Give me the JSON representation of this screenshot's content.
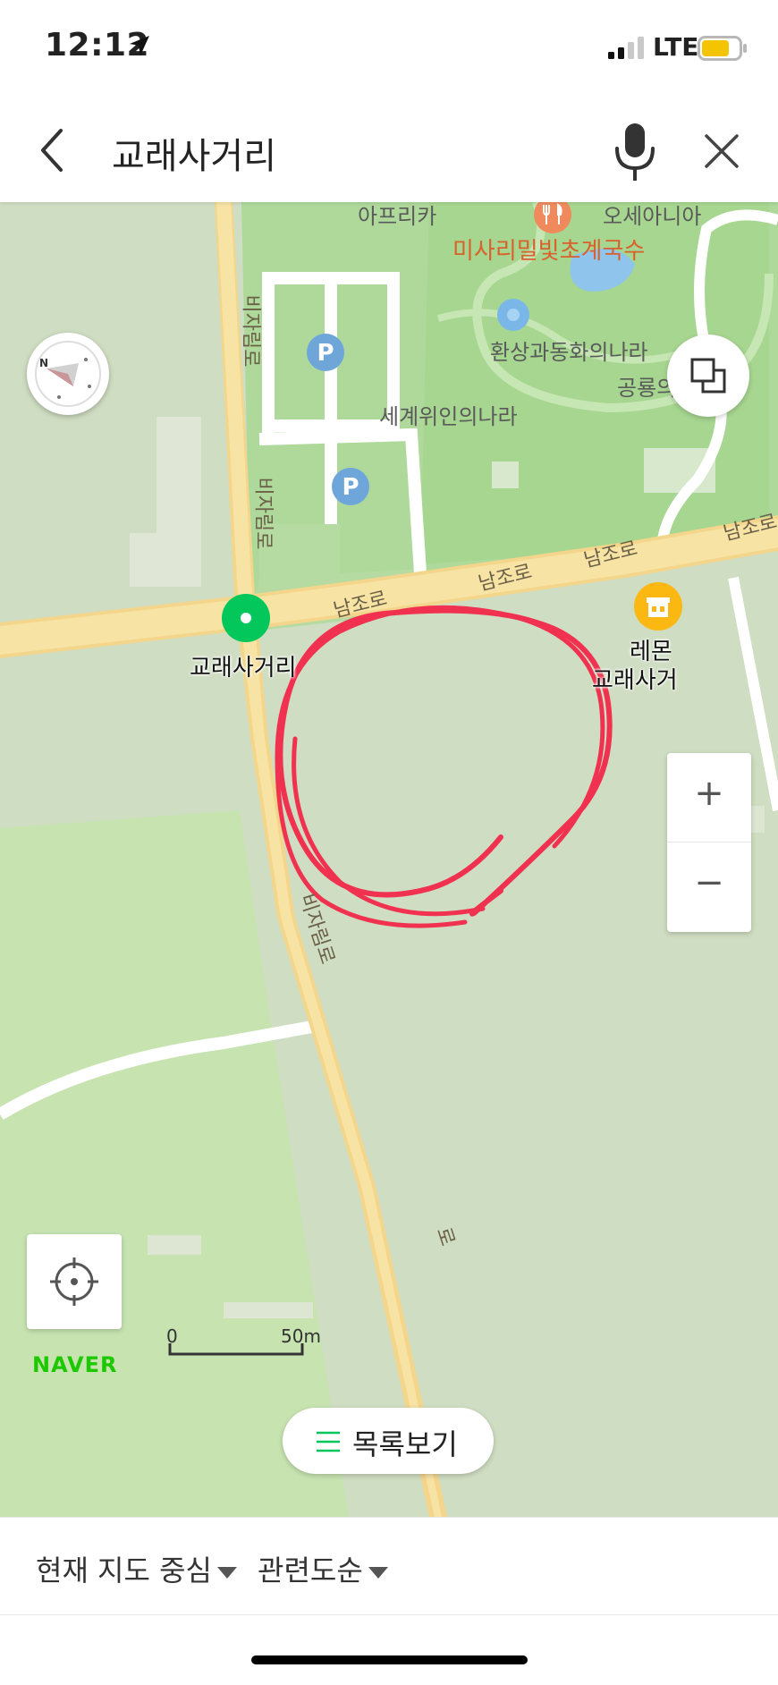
{
  "status_bar": {
    "time": "12:12",
    "network": "LTE",
    "location_icon": "location-arrow-icon",
    "signal_icon": "signal-bars-icon",
    "battery_icon": "battery-low-icon",
    "battery_color": "#f5c400"
  },
  "search": {
    "query": "교래사거리",
    "back_icon": "chevron-left-icon",
    "mic_icon": "microphone-icon",
    "clear_icon": "close-icon"
  },
  "map": {
    "place_labels": {
      "africa": "아프리카",
      "oceania": "오세아니아",
      "restaurant": "미사리밀빛초계국수",
      "fantasy": "환상과동화의나라",
      "dinosaur": "공룡의나라",
      "great_people": "세계위인의나라",
      "selected_place": "교래사거리",
      "lemon_line1": "레몬",
      "lemon_line2": "교래사거"
    },
    "road_labels": {
      "bija_1": "비자림로",
      "bija_2": "비자림로",
      "bija_3": "비자림로",
      "bija_4": "로",
      "namjo_1": "남조로",
      "namjo_2": "남조로",
      "namjo_3": "남조로",
      "namjo_4": "남조로"
    },
    "colors": {
      "road": "#f7e3a4",
      "park": "#aed99a",
      "land": "#cfddc2",
      "marker_green": "#03c75a",
      "annotation_red": "#f0314f",
      "store_pin": "#fbb813"
    },
    "icons": {
      "compass": "compass-icon",
      "layers": "layers-icon",
      "parking": "parking-icon",
      "restaurant": "fork-knife-icon",
      "store": "store-icon",
      "locate": "crosshair-icon"
    },
    "zoom": {
      "in": "+",
      "out": "−"
    },
    "brand": "NAVER",
    "scale": {
      "start": "0",
      "end": "50m"
    },
    "list_button": "목록보기"
  },
  "sort_bar": {
    "center_option": "현재 지도 중심",
    "order_option": "관련도순"
  }
}
